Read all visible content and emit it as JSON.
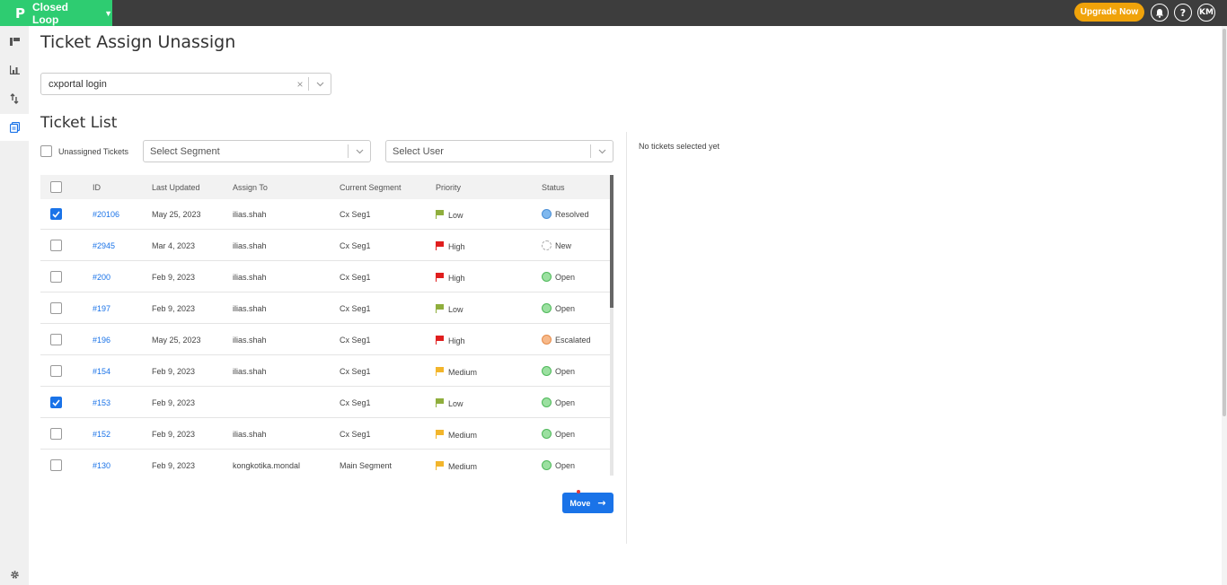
{
  "header": {
    "app_name": "Closed Loop",
    "logo_glyph": "P",
    "caret": "▼",
    "upgrade_label": "Upgrade Now",
    "bell_icon": "bell-icon",
    "help_glyph": "?",
    "avatar_initials": "KM"
  },
  "sidebar": {
    "items": [
      {
        "icon": "board-icon",
        "glyph": "▮▮"
      },
      {
        "icon": "bar-chart-icon",
        "glyph": "▁▃▅"
      },
      {
        "icon": "sort-arrows-icon",
        "glyph": "⇅"
      },
      {
        "icon": "ticket-icon",
        "glyph": "▣",
        "active": true
      }
    ],
    "settings_icon": "gear-icon",
    "settings_glyph": "⚙"
  },
  "page": {
    "title": "Ticket Assign Unassign",
    "portal_select": {
      "value": "cxportal login",
      "clear": "×",
      "chevron": "⌄"
    },
    "section_title": "Ticket List",
    "unassigned_label": "Unassigned Tickets",
    "segment_placeholder": "Select Segment",
    "user_placeholder": "Select User",
    "chevron": "⌄",
    "move_label": "Move",
    "move_arrow": "→",
    "no_tickets": "No tickets selected yet"
  },
  "table": {
    "headers": [
      "ID",
      "Last Updated",
      "Assign To",
      "Current Segment",
      "Priority",
      "Status"
    ],
    "rows": [
      {
        "checked": true,
        "id": "#20106",
        "updated": "May 25, 2023",
        "assign": "ilias.shah",
        "segment": "Cx Seg1",
        "priority": "Low",
        "status": "Resolved"
      },
      {
        "checked": false,
        "id": "#2945",
        "updated": "Mar 4, 2023",
        "assign": "ilias.shah",
        "segment": "Cx Seg1",
        "priority": "High",
        "status": "New"
      },
      {
        "checked": false,
        "id": "#200",
        "updated": "Feb 9, 2023",
        "assign": "ilias.shah",
        "segment": "Cx Seg1",
        "priority": "High",
        "status": "Open"
      },
      {
        "checked": false,
        "id": "#197",
        "updated": "Feb 9, 2023",
        "assign": "ilias.shah",
        "segment": "Cx Seg1",
        "priority": "Low",
        "status": "Open"
      },
      {
        "checked": false,
        "id": "#196",
        "updated": "May 25, 2023",
        "assign": "ilias.shah",
        "segment": "Cx Seg1",
        "priority": "High",
        "status": "Escalated"
      },
      {
        "checked": false,
        "id": "#154",
        "updated": "Feb 9, 2023",
        "assign": "ilias.shah",
        "segment": "Cx Seg1",
        "priority": "Medium",
        "status": "Open"
      },
      {
        "checked": true,
        "id": "#153",
        "updated": "Feb 9, 2023",
        "assign": "",
        "segment": "Cx Seg1",
        "priority": "Low",
        "status": "Open"
      },
      {
        "checked": false,
        "id": "#152",
        "updated": "Feb 9, 2023",
        "assign": "ilias.shah",
        "segment": "Cx Seg1",
        "priority": "Medium",
        "status": "Open"
      },
      {
        "checked": false,
        "id": "#130",
        "updated": "Feb 9, 2023",
        "assign": "kongkotika.mondal",
        "segment": "Main Segment",
        "priority": "Medium",
        "status": "Open"
      }
    ]
  },
  "colors": {
    "priority": {
      "Low": "#8fae3c",
      "High": "#e01e1e",
      "Medium": "#f2b52b"
    },
    "status": {
      "Resolved": {
        "fill": "#7fb8ee",
        "border": "#4a8fd6"
      },
      "New": {
        "fill": "#ffffff",
        "border": "#aaaaaa",
        "dashed": true
      },
      "Open": {
        "fill": "#9be0a0",
        "border": "#4fb85a"
      },
      "Escalated": {
        "fill": "#f7b98a",
        "border": "#e58c4a"
      }
    },
    "brand": "#2ecc71",
    "accent": "#1a73e8",
    "upgrade": "#f0a30a"
  }
}
